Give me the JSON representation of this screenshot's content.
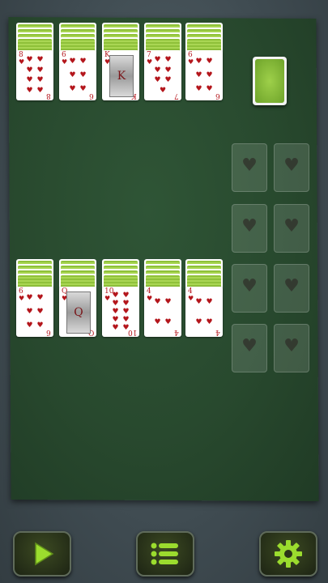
{
  "tableau_top": [
    {
      "rank": "8",
      "suit": "♥",
      "pips": 8,
      "court": false
    },
    {
      "rank": "6",
      "suit": "♥",
      "pips": 6,
      "court": false
    },
    {
      "rank": "K",
      "suit": "♥",
      "pips": 0,
      "court": true
    },
    {
      "rank": "7",
      "suit": "♥",
      "pips": 7,
      "court": false
    },
    {
      "rank": "6",
      "suit": "♥",
      "pips": 6,
      "court": false
    }
  ],
  "tableau_bottom": [
    {
      "rank": "6",
      "suit": "♥",
      "pips": 6,
      "court": false
    },
    {
      "rank": "Q",
      "suit": "♥",
      "pips": 0,
      "court": true
    },
    {
      "rank": "10",
      "suit": "♥",
      "pips": 10,
      "court": false
    },
    {
      "rank": "4",
      "suit": "♥",
      "pips": 4,
      "court": false
    },
    {
      "rank": "4",
      "suit": "♥",
      "pips": 4,
      "court": false
    }
  ],
  "foundation_suit": "♥",
  "foundation_slots": 8,
  "colors": {
    "felt": "#28492e",
    "card_back": "#8fc13a",
    "suit": "#b4161c",
    "button_icon": "#9bdc2e"
  },
  "buttons": [
    {
      "icon": "play-icon"
    },
    {
      "icon": "menu-list-icon"
    },
    {
      "icon": "gear-icon"
    }
  ]
}
